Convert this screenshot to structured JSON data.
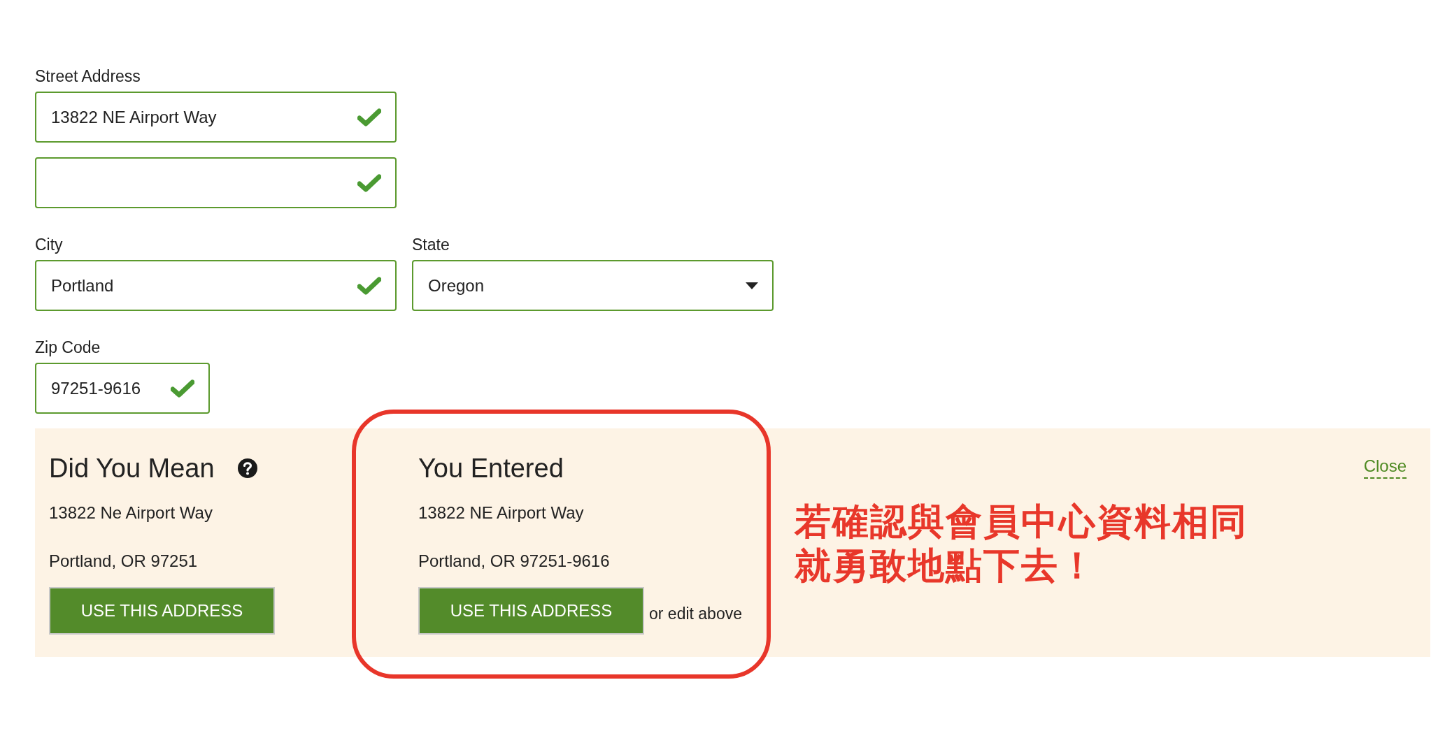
{
  "form": {
    "rows": [
      [
        {
          "kind": "text",
          "label": "Street Address",
          "value": "13822 NE Airport Way",
          "valid": true
        }
      ],
      [
        {
          "kind": "text",
          "valid": true
        }
      ],
      [
        {
          "kind": "text",
          "label": "City",
          "value": "Portland",
          "valid": true
        },
        {
          "kind": "select",
          "label": "State",
          "value": "Oregon"
        }
      ],
      [
        {
          "kind": "short",
          "label": "Zip Code",
          "value": "97251-9616",
          "valid": true
        }
      ]
    ]
  },
  "suggestions": {
    "options": [
      {
        "heading": "Did You Mean",
        "help": true,
        "lines": [
          "13822 Ne Airport Way",
          "Portland, OR 97251"
        ],
        "button": "USE THIS ADDRESS",
        "highlighted": false
      },
      {
        "heading": "You Entered",
        "help": false,
        "lines": [
          "13822 NE Airport Way",
          "Portland, OR 97251-9616"
        ],
        "button": "USE THIS ADDRESS",
        "note": "or edit above",
        "highlighted": true
      }
    ],
    "annotation": [
      "若確認與會員中心資料相同",
      "就勇敢地點下去！"
    ],
    "close": "Close"
  }
}
